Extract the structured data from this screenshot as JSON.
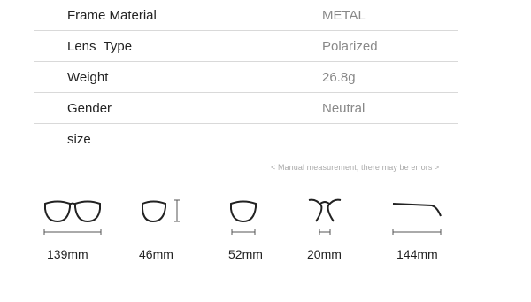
{
  "specs": [
    {
      "label": "Frame Material",
      "value": "METAL"
    },
    {
      "label": "Lens  Type",
      "value": "Polarized"
    },
    {
      "label": "Weight",
      "value": "26.8g"
    },
    {
      "label": "Gender",
      "value": "Neutral"
    },
    {
      "label": "size",
      "value": ""
    }
  ],
  "note": "< Manual measurement, there may be errors >",
  "measurements": [
    {
      "name": "frame-width",
      "value": "139mm",
      "icon": "glasses-front-icon"
    },
    {
      "name": "lens-width",
      "value": "46mm",
      "icon": "lens-height-icon"
    },
    {
      "name": "lens-height",
      "value": "52mm",
      "icon": "single-lens-icon"
    },
    {
      "name": "bridge-width",
      "value": "20mm",
      "icon": "bridge-icon"
    },
    {
      "name": "temple-length",
      "value": "144mm",
      "icon": "temple-arm-icon"
    }
  ]
}
